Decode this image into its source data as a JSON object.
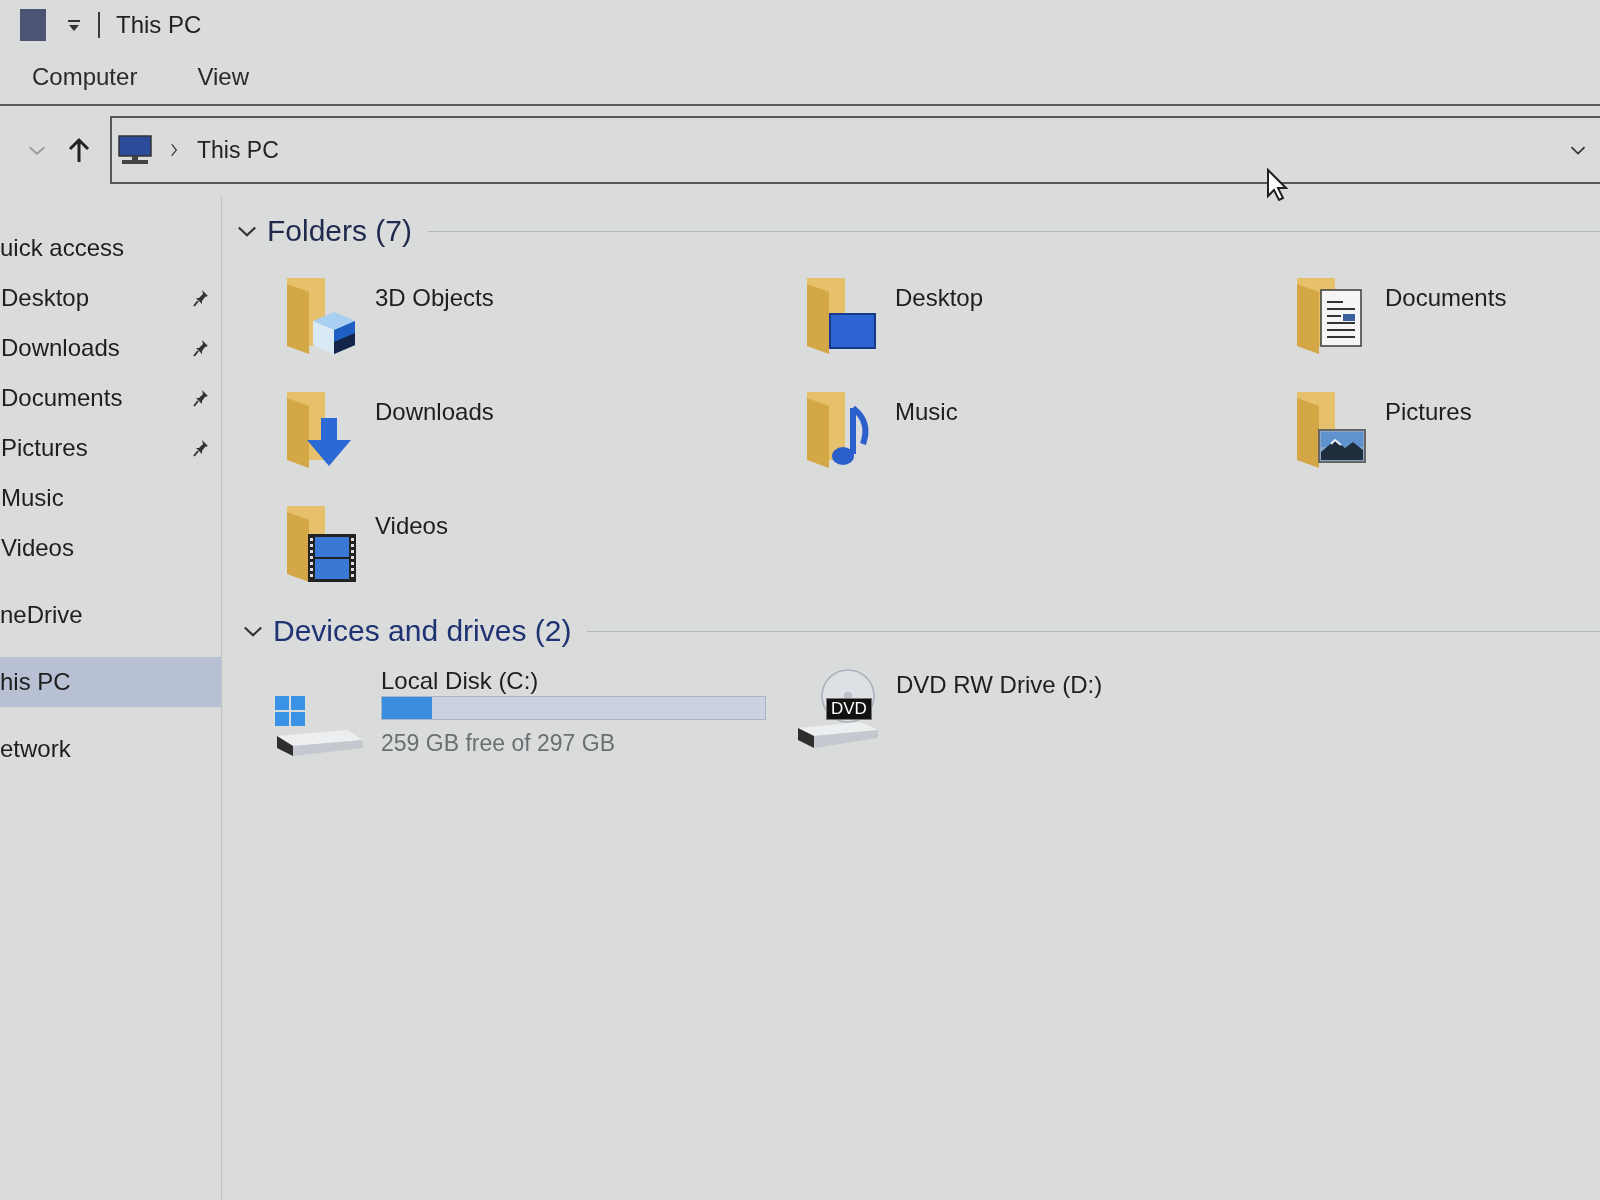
{
  "title_bar": {
    "title": "This PC"
  },
  "ribbon": {
    "tabs": [
      {
        "label": "Computer",
        "selected": false
      },
      {
        "label": "View",
        "selected": false
      }
    ]
  },
  "address_bar": {
    "path": [
      "This PC"
    ]
  },
  "sidebar": {
    "items": [
      {
        "label": "uick access",
        "selected": false,
        "children": [
          {
            "label": "Desktop",
            "pinned": true,
            "selected": false
          },
          {
            "label": "Downloads",
            "pinned": true,
            "selected": false
          },
          {
            "label": "Documents",
            "pinned": true,
            "selected": false
          },
          {
            "label": "Pictures",
            "pinned": true,
            "selected": false
          },
          {
            "label": "Music",
            "pinned": false,
            "selected": false
          },
          {
            "label": "Videos",
            "pinned": false,
            "selected": false
          }
        ]
      },
      {
        "label": "neDrive",
        "selected": false
      },
      {
        "label": "his PC",
        "selected": true
      },
      {
        "label": "etwork",
        "selected": false
      }
    ]
  },
  "folders": {
    "title": "Folders (7)",
    "expanded": true,
    "items": [
      {
        "name": "3D Objects",
        "kind": "objects"
      },
      {
        "name": "Desktop",
        "kind": "desktop"
      },
      {
        "name": "Documents",
        "kind": "documents"
      },
      {
        "name": "Downloads",
        "kind": "downloads"
      },
      {
        "name": "Music",
        "kind": "music"
      },
      {
        "name": "Pictures",
        "kind": "pictures"
      },
      {
        "name": "Videos",
        "kind": "videos"
      }
    ]
  },
  "drives": {
    "title": "Devices and drives (2)",
    "expanded": true,
    "items": [
      {
        "name": "Local Disk (C:)",
        "kind": "system",
        "level": 0.13,
        "reading": "259 GB free of 297 GB"
      },
      {
        "name": "DVD RW Drive (D:)",
        "kind": "dvd",
        "badge": "DVD"
      }
    ]
  }
}
